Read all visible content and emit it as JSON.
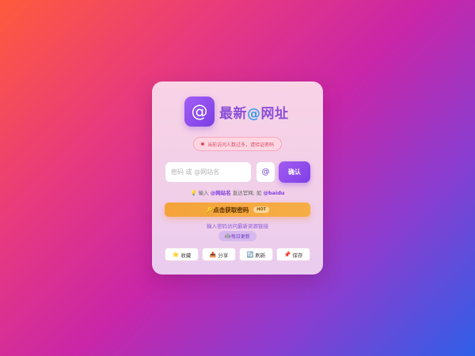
{
  "logo": {
    "icon": "@",
    "icon_name": "at-sign-icon",
    "title_part1": "最新",
    "title_at": "@",
    "title_part2": "网址"
  },
  "notice": {
    "text": "当前访问人数过多，请验证密码"
  },
  "form": {
    "input_placeholder": "密码 或 @网站名",
    "input_value": "",
    "at_button_label": "@",
    "confirm_label": "确认"
  },
  "hint": {
    "icon": "💡",
    "prefix": "输入 ",
    "keyword1": "@网站名",
    "middle": " 直达官网, 如 ",
    "keyword2": "@baidu"
  },
  "get_password": {
    "icon": "🔑",
    "label": "点击获取密码",
    "badge": "HOT"
  },
  "sub_link": "输入密码访问最新资源链接",
  "daily": {
    "icon": "🤖",
    "label": "每日更新"
  },
  "actions": [
    {
      "icon": "⭐",
      "icon_name": "star-icon",
      "label": "收藏"
    },
    {
      "icon": "📤",
      "icon_name": "share-icon",
      "label": "分享"
    },
    {
      "icon": "🔄",
      "icon_name": "refresh-icon",
      "label": "刷新"
    },
    {
      "icon": "📌",
      "icon_name": "pin-icon",
      "label": "保存"
    }
  ],
  "colors": {
    "accent": "#8a4fd8",
    "button": "#7f3fe6",
    "hot_button": "#f4a33a",
    "notice_text": "#d64c6a"
  }
}
